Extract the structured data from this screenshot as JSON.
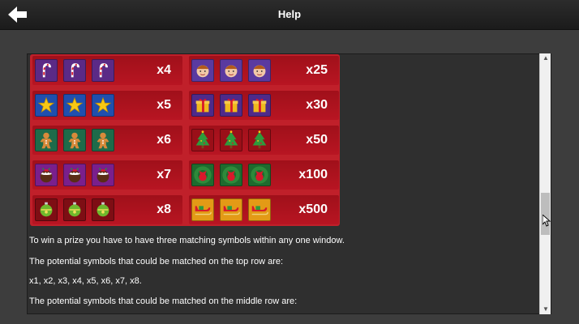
{
  "header": {
    "title": "Help"
  },
  "paytable": {
    "left": [
      {
        "symbol": "candy-cane-icon",
        "bg": "#5b2a86",
        "multiplier": "x4"
      },
      {
        "symbol": "star-icon",
        "bg": "#1f4fae",
        "multiplier": "x5"
      },
      {
        "symbol": "gingerbread-man-icon",
        "bg": "#1e6b4a",
        "multiplier": "x6"
      },
      {
        "symbol": "christmas-pudding-icon",
        "bg": "#7a1f8c",
        "multiplier": "x7"
      },
      {
        "symbol": "bauble-icon",
        "bg": "#7e0e14",
        "multiplier": "x8"
      }
    ],
    "right": [
      {
        "symbol": "elf-icon",
        "bg": "#5a3aa0",
        "multiplier": "x25"
      },
      {
        "symbol": "gift-box-icon",
        "bg": "#4e2a8a",
        "multiplier": "x30"
      },
      {
        "symbol": "christmas-tree-icon",
        "bg": "#9a0f18",
        "multiplier": "x50"
      },
      {
        "symbol": "wreath-icon",
        "bg": "#1e6b2e",
        "multiplier": "x100"
      },
      {
        "symbol": "sleigh-icon",
        "bg": "#e39a16",
        "multiplier": "x500"
      }
    ]
  },
  "text": {
    "p1": "To win a prize you have to have three matching symbols within any one window.",
    "p2": "The potential symbols that could be matched on the top row are:",
    "p3": "x1, x2, x3, x4, x5, x6, x7, x8.",
    "p4": "The potential symbols that could be matched on the middle row are:"
  },
  "colors": {
    "paytable_red": "#c0202a",
    "panel_bg": "#2f2f2f",
    "page_bg": "#3d3d3d"
  }
}
